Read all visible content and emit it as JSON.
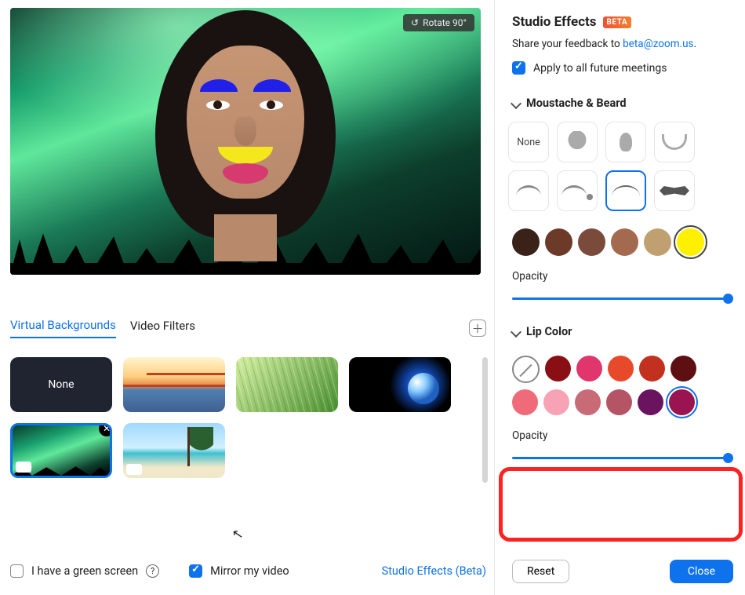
{
  "preview": {
    "rotate_label": "Rotate 90°"
  },
  "tabs": {
    "virtual_backgrounds": "Virtual Backgrounds",
    "video_filters": "Video Filters"
  },
  "backgrounds": {
    "none": "None"
  },
  "left_bottom": {
    "green_screen": "I have a green screen",
    "mirror": "Mirror my video",
    "studio_link": "Studio Effects (Beta)"
  },
  "panel": {
    "title": "Studio Effects",
    "beta": "BETA",
    "feedback_prefix": "Share your feedback to ",
    "feedback_email": "beta@zoom.us",
    "apply_all": "Apply to all future meetings"
  },
  "moustache": {
    "heading": "Moustache & Beard",
    "none": "None",
    "opacity": "Opacity",
    "opacity_value": 100,
    "colors": [
      "#3a2218",
      "#6b3a28",
      "#7a4a3a",
      "#a46a50",
      "#c0a070",
      "#fff000"
    ],
    "selected_color_index": 5,
    "selected_style_index": 6
  },
  "lip": {
    "heading": "Lip Color",
    "opacity": "Opacity",
    "opacity_value": 100,
    "colors_row1": [
      "none",
      "#8a0f14",
      "#e0356d",
      "#e7492b",
      "#c23020",
      "#5d0f12"
    ],
    "colors_row2": [
      "#ef6b7a",
      "#f7a2b5",
      "#c96b77",
      "#b55464",
      "#6a1460",
      "#9a1452"
    ],
    "selected_index": 11
  },
  "buttons": {
    "reset": "Reset",
    "close": "Close"
  }
}
